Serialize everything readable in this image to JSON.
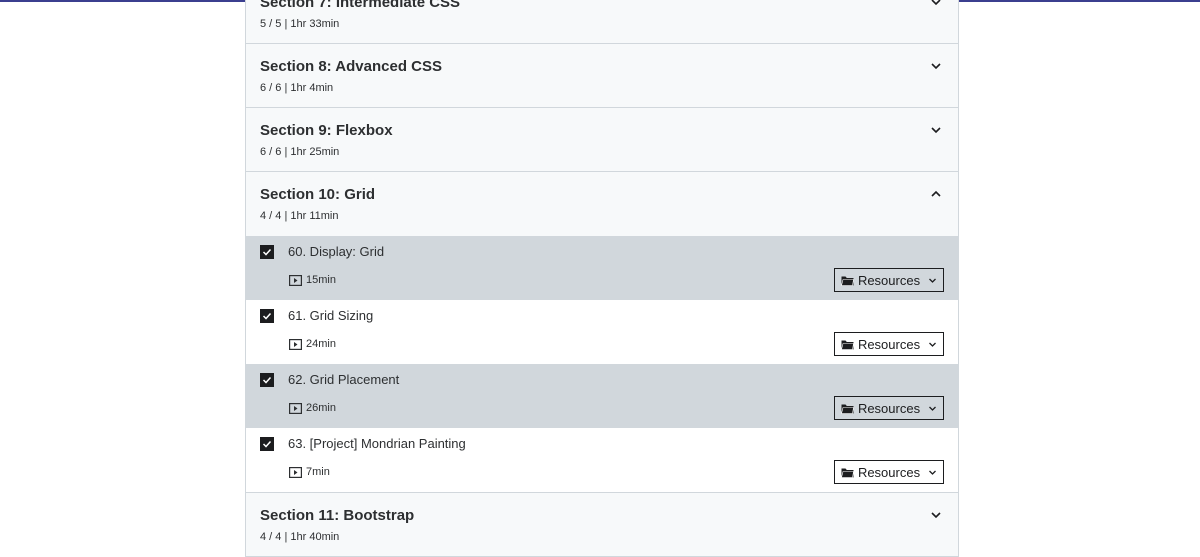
{
  "sections": [
    {
      "title": "Section 7: Intermediate CSS",
      "meta": "5 / 5 | 1hr 33min",
      "expanded": false
    },
    {
      "title": "Section 8: Advanced CSS",
      "meta": "6 / 6 | 1hr 4min",
      "expanded": false
    },
    {
      "title": "Section 9: Flexbox",
      "meta": "6 / 6 | 1hr 25min",
      "expanded": false
    },
    {
      "title": "Section 10: Grid",
      "meta": "4 / 4 | 1hr 11min",
      "expanded": true
    },
    {
      "title": "Section 11: Bootstrap",
      "meta": "4 / 4 | 1hr 40min",
      "expanded": false
    }
  ],
  "lectures": [
    {
      "title": "60. Display: Grid",
      "duration": "15min",
      "completed": true,
      "resources_label": "Resources",
      "highlighted": true
    },
    {
      "title": "61. Grid Sizing",
      "duration": "24min",
      "completed": true,
      "resources_label": "Resources",
      "highlighted": false
    },
    {
      "title": "62. Grid Placement",
      "duration": "26min",
      "completed": true,
      "resources_label": "Resources",
      "highlighted": true
    },
    {
      "title": "63. [Project] Mondrian Painting",
      "duration": "7min",
      "completed": true,
      "resources_label": "Resources",
      "highlighted": false
    }
  ],
  "icons": {
    "chevron_down": "chevron-down-icon",
    "chevron_up": "chevron-up-icon",
    "checkbox": "checkmark-icon",
    "video": "play-icon",
    "folder": "folder-icon"
  },
  "colors": {
    "top_line": "#3b3f8f",
    "section_bg": "#f7f9fa",
    "highlight_bg": "#d1d7dc",
    "text": "#2d2f31"
  }
}
